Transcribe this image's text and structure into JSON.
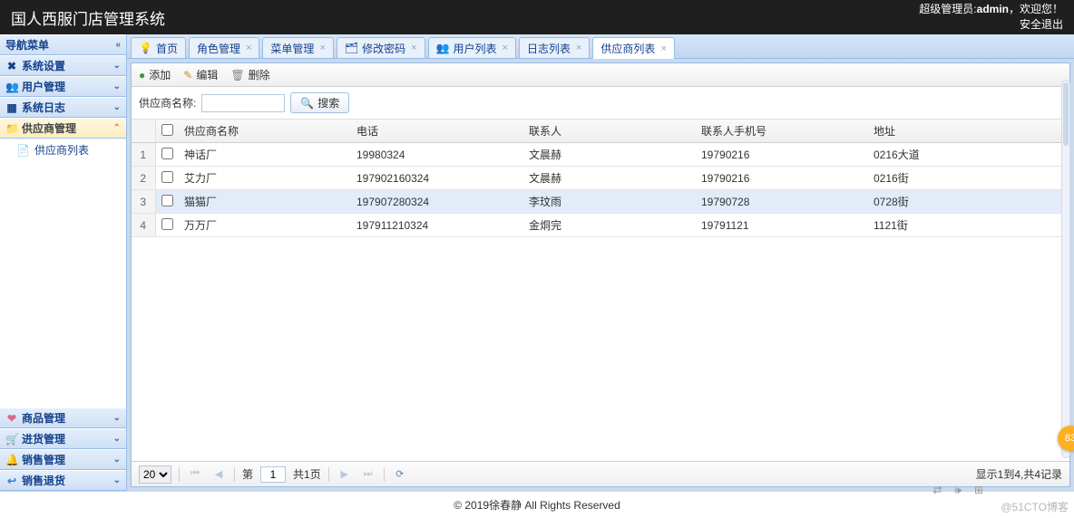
{
  "header": {
    "title": "国人西服门店管理系统",
    "welcome_prefix": "超级管理员:",
    "welcome_user": "admin",
    "welcome_suffix": "，欢迎您！",
    "logout": "安全退出"
  },
  "sidebar": {
    "title": "导航菜单",
    "groups": [
      {
        "label": "系统设置",
        "icon": "✖",
        "expanded": false,
        "selected": false
      },
      {
        "label": "用户管理",
        "icon": "👥",
        "expanded": false,
        "selected": false
      },
      {
        "label": "系统日志",
        "icon": "▦",
        "expanded": false,
        "selected": false
      },
      {
        "label": "供应商管理",
        "icon": "📁",
        "expanded": true,
        "selected": true,
        "children": [
          {
            "label": "供应商列表",
            "icon": "📄"
          }
        ]
      }
    ],
    "bottom_groups": [
      {
        "label": "商品管理",
        "icon": "❤"
      },
      {
        "label": "进货管理",
        "icon": "🛒"
      },
      {
        "label": "销售管理",
        "icon": "🔔"
      },
      {
        "label": "销售退货",
        "icon": "↩"
      }
    ]
  },
  "tabs": [
    {
      "label": "首页",
      "icon": "💡",
      "closable": false,
      "active": false
    },
    {
      "label": "角色管理",
      "icon": "",
      "closable": true,
      "active": false
    },
    {
      "label": "菜单管理",
      "icon": "",
      "closable": true,
      "active": false
    },
    {
      "label": "修改密码",
      "icon": "🗂",
      "closable": true,
      "active": false
    },
    {
      "label": "用户列表",
      "icon": "👥",
      "closable": true,
      "active": false
    },
    {
      "label": "日志列表",
      "icon": "",
      "closable": true,
      "active": false
    },
    {
      "label": "供应商列表",
      "icon": "",
      "closable": true,
      "active": true
    }
  ],
  "toolbar": {
    "add": "添加",
    "edit": "编辑",
    "delete": "删除"
  },
  "search": {
    "label": "供应商名称:",
    "value": "",
    "button": "搜索"
  },
  "grid": {
    "columns": [
      "供应商名称",
      "电话",
      "联系人",
      "联系人手机号",
      "地址"
    ],
    "rows": [
      {
        "n": "1",
        "name": "神话厂",
        "phone": "19980324",
        "contact": "文晨赫",
        "mobile": "19790216",
        "address": "0216大道"
      },
      {
        "n": "2",
        "name": "艾力厂",
        "phone": "197902160324",
        "contact": "文晨赫",
        "mobile": "19790216",
        "address": "0216街"
      },
      {
        "n": "3",
        "name": "猫猫厂",
        "phone": "197907280324",
        "contact": "李玟雨",
        "mobile": "19790728",
        "address": "0728街"
      },
      {
        "n": "4",
        "name": "万万厂",
        "phone": "197911210324",
        "contact": "金烔完",
        "mobile": "19791121",
        "address": "1121街"
      }
    ]
  },
  "pager": {
    "page_size": "20",
    "page_label_prefix": "第",
    "page": "1",
    "page_label_suffix": "共1页",
    "info": "显示1到4,共4记录"
  },
  "footer": "© 2019徐春静 All Rights Reserved",
  "badge": "83",
  "watermark": "@51CTO博客"
}
